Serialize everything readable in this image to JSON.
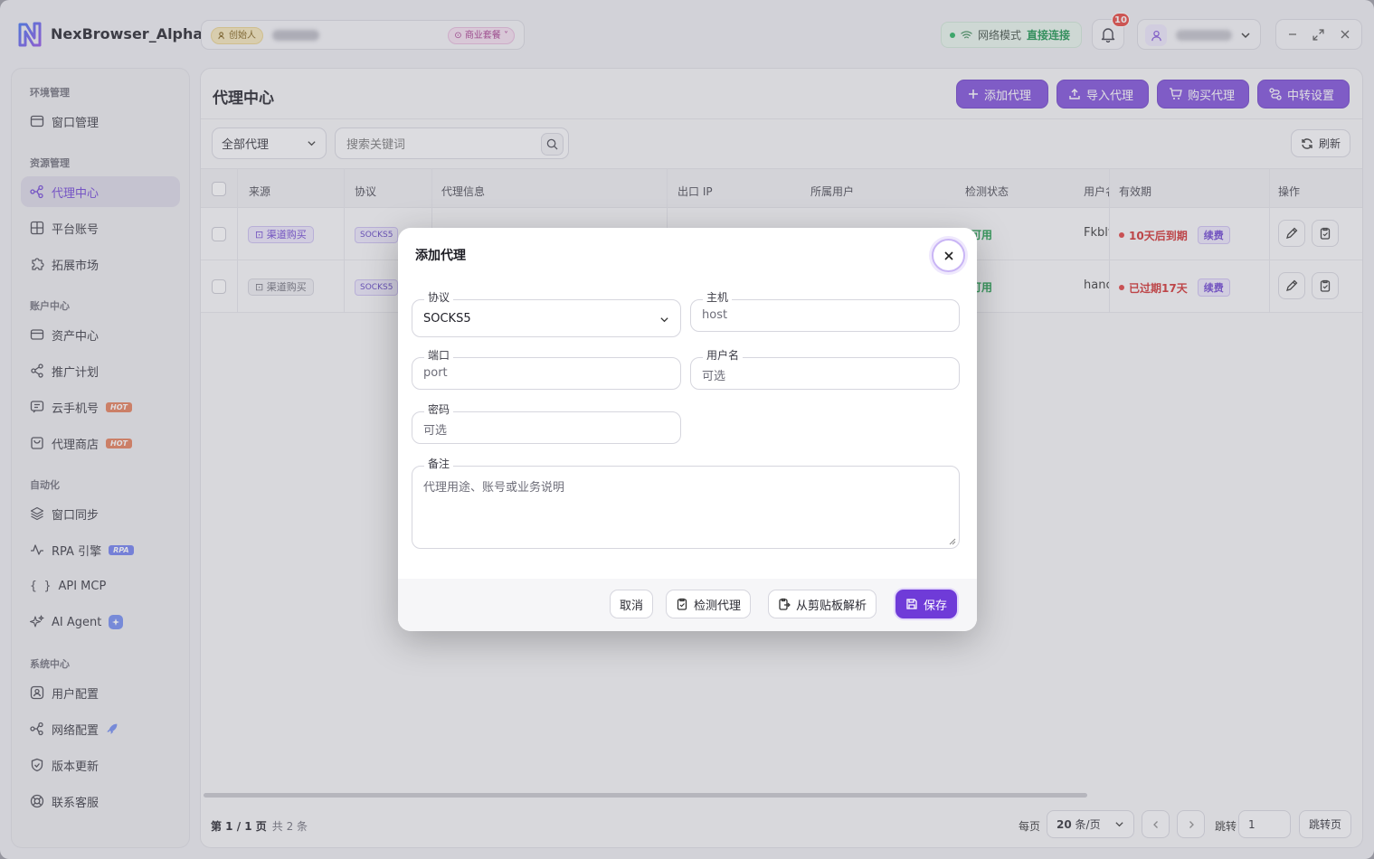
{
  "app": {
    "title": "NexBrowser_Alpha",
    "role_badge": "创始人",
    "plan_badge": "商业套餐"
  },
  "network": {
    "label": "网络模式",
    "status": "直接连接"
  },
  "notifications": {
    "count": "10"
  },
  "sidebar": {
    "groups": [
      {
        "label": "环境管理",
        "items": [
          {
            "label": "窗口管理",
            "icon": "window-icon"
          }
        ]
      },
      {
        "label": "资源管理",
        "items": [
          {
            "label": "代理中心",
            "icon": "proxy-icon",
            "active": true
          },
          {
            "label": "平台账号",
            "icon": "grid-icon"
          },
          {
            "label": "拓展市场",
            "icon": "puzzle-icon"
          }
        ]
      },
      {
        "label": "账户中心",
        "items": [
          {
            "label": "资产中心",
            "icon": "card-icon"
          },
          {
            "label": "推广计划",
            "icon": "share-icon"
          },
          {
            "label": "云手机号",
            "icon": "message-icon",
            "badge": "HOT"
          },
          {
            "label": "代理商店",
            "icon": "shop-icon",
            "badge": "HOT"
          }
        ]
      },
      {
        "label": "自动化",
        "items": [
          {
            "label": "窗口同步",
            "icon": "layers-icon"
          },
          {
            "label": "RPA 引擎",
            "icon": "pulse-icon",
            "badge": "RPA"
          },
          {
            "label": "API MCP",
            "icon": "braces-icon"
          },
          {
            "label": "AI Agent",
            "icon": "sparkle-icon"
          }
        ]
      },
      {
        "label": "系统中心",
        "items": [
          {
            "label": "用户配置",
            "icon": "user-config-icon"
          },
          {
            "label": "网络配置",
            "icon": "network-icon"
          },
          {
            "label": "版本更新",
            "icon": "shield-icon"
          },
          {
            "label": "联系客服",
            "icon": "support-icon"
          }
        ]
      }
    ]
  },
  "page": {
    "title": "代理中心",
    "actions": {
      "add": "添加代理",
      "import": "导入代理",
      "buy": "购买代理",
      "relay": "中转设置"
    },
    "filter": "全部代理",
    "search_placeholder": "搜索关键词",
    "refresh": "刷新",
    "columns": [
      "来源",
      "协议",
      "代理信息",
      "出口 IP",
      "所属用户",
      "检测状态",
      "用户名",
      "有效期",
      "操作"
    ],
    "rows": [
      {
        "source": "渠道购买",
        "protocol": "SOCKS5",
        "status": "可用",
        "username": "Fkblt",
        "expiry": "10天后到期",
        "renew": "续费"
      },
      {
        "source": "渠道购买",
        "protocol": "SOCKS5",
        "status": "可用",
        "username": "hanc",
        "expiry": "已过期17天",
        "renew": "续费"
      }
    ],
    "pager": {
      "page": "第 1 / 1 页",
      "total": "共 2 条",
      "per_page_label": "每页",
      "per_page_value": "20",
      "per_page_unit": "条/页",
      "jump_label": "跳转",
      "jump_value": "1",
      "jump_button": "跳转页"
    }
  },
  "dialog": {
    "title": "添加代理",
    "fields": {
      "protocol": {
        "label": "协议",
        "value": "SOCKS5"
      },
      "host": {
        "label": "主机",
        "placeholder": "host"
      },
      "port": {
        "label": "端口",
        "placeholder": "port"
      },
      "username": {
        "label": "用户名",
        "placeholder": "可选"
      },
      "password": {
        "label": "密码",
        "placeholder": "可选"
      },
      "note": {
        "label": "备注",
        "placeholder": "代理用途、账号或业务说明"
      }
    },
    "buttons": {
      "cancel": "取消",
      "check": "检测代理",
      "parse": "从剪贴板解析",
      "save": "保存"
    }
  },
  "colors": {
    "accent": "#7a4ad8",
    "success": "#16924a",
    "danger": "#d02a2a"
  }
}
